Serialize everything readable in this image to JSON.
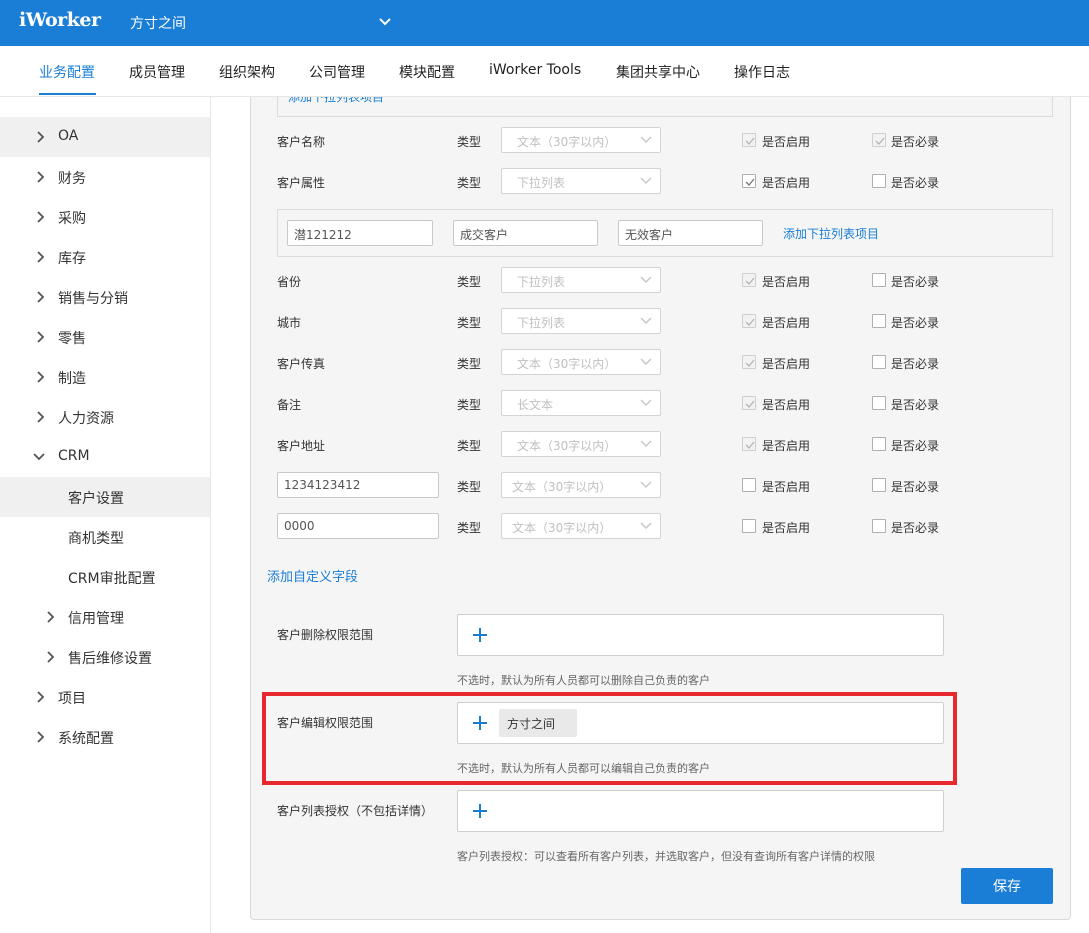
{
  "header": {
    "logo": "iWorker",
    "company": "方寸之间"
  },
  "nav": {
    "items": [
      "业务配置",
      "成员管理",
      "组织架构",
      "公司管理",
      "模块配置",
      "iWorker Tools",
      "集团共享中心",
      "操作日志"
    ],
    "active_index": 0
  },
  "sidebar": {
    "items": [
      "OA",
      "财务",
      "采购",
      "库存",
      "销售与分销",
      "零售",
      "制造",
      "人力资源",
      "CRM",
      "客户设置",
      "商机类型",
      "CRM审批配置",
      "信用管理",
      "售后维修设置",
      "项目",
      "系统配置"
    ],
    "selected": "客户设置",
    "expanded": "CRM"
  },
  "form": {
    "top_partial_link": "添加下拉列表项目",
    "type_label": "类型",
    "enable_label": "是否启用",
    "required_label": "是否必录",
    "fields": [
      {
        "name": "客户名称",
        "type": "文本（30字以内）",
        "enabled": true,
        "required": true,
        "locked": true
      },
      {
        "name": "客户属性",
        "type": "下拉列表",
        "enabled": true,
        "required": false,
        "locked": false
      },
      {
        "name": "省份",
        "type": "下拉列表",
        "enabled": true,
        "required": false,
        "locked": true
      },
      {
        "name": "城市",
        "type": "下拉列表",
        "enabled": true,
        "required": false,
        "locked": true
      },
      {
        "name": "客户传真",
        "type": "文本（30字以内）",
        "enabled": true,
        "required": false,
        "locked": true
      },
      {
        "name": "备注",
        "type": "长文本",
        "enabled": true,
        "required": false,
        "locked": true
      },
      {
        "name": "客户地址",
        "type": "文本（30字以内）",
        "enabled": true,
        "required": false,
        "locked": true
      },
      {
        "name": "1234123412",
        "type": "文本（30字以内）",
        "enabled": false,
        "required": false,
        "custom": true
      },
      {
        "name": "0000",
        "type": "文本（30字以内）",
        "enabled": false,
        "required": false,
        "custom": true
      }
    ],
    "dropdown_items": [
      "潜121212",
      "成交客户",
      "无效客户"
    ],
    "add_dropdown_link": "添加下拉列表项目",
    "add_custom_field_link": "添加自定义字段"
  },
  "permissions": {
    "delete": {
      "label": "客户删除权限范围",
      "hint": "不选时，默认为所有人员都可以删除自己负责的客户",
      "tags": []
    },
    "edit": {
      "label": "客户编辑权限范围",
      "hint": "不选时，默认为所有人员都可以编辑自己负责的客户",
      "tags": [
        "方寸之间"
      ]
    },
    "list": {
      "label": "客户列表授权（不包括详情）",
      "hint": "客户列表授权：可以查看所有客户列表，并选取客户，但没有查询所有客户详情的权限",
      "tags": []
    }
  },
  "save_label": "保存",
  "colors": {
    "primary": "#1a7dd6",
    "highlight_frame": "#e8282f"
  }
}
